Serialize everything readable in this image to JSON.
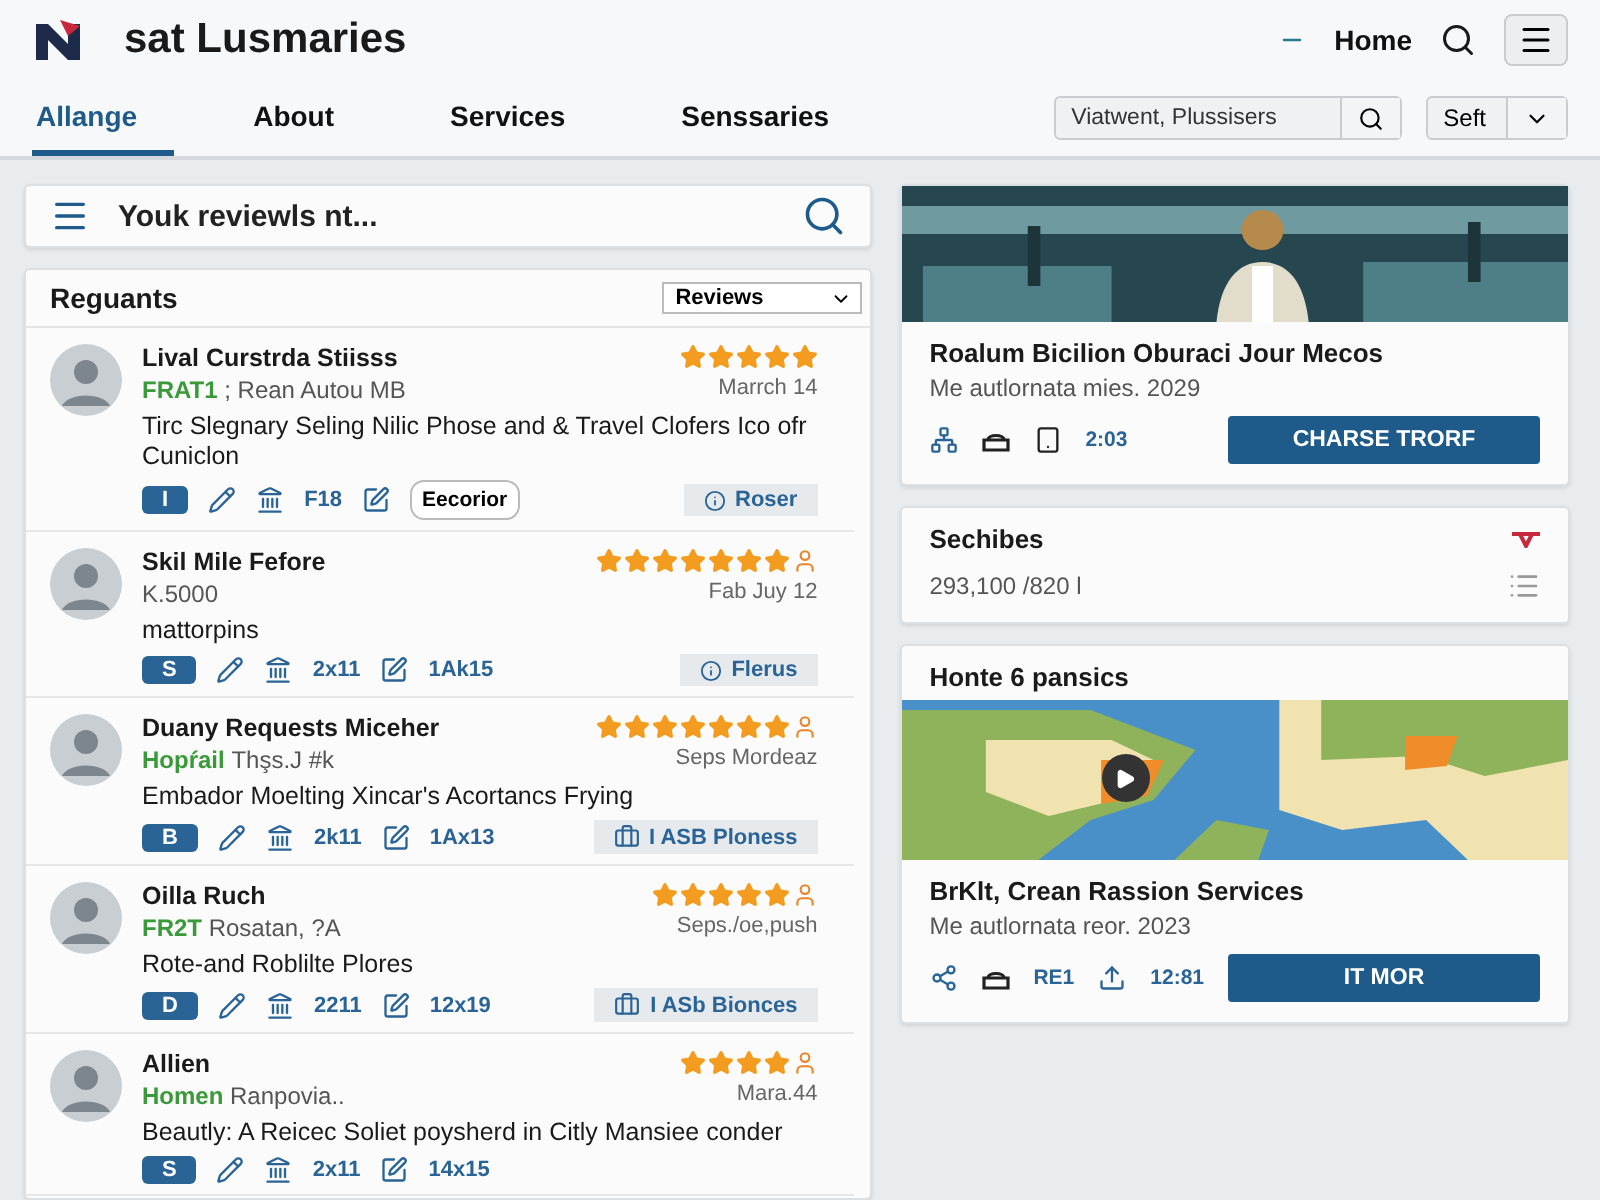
{
  "header": {
    "brand": "sat Lusmaries",
    "nav": "Home"
  },
  "tabs": [
    {
      "label": "Allange",
      "selected": true
    },
    {
      "label": "About",
      "selected": false
    },
    {
      "label": "Services",
      "selected": false
    },
    {
      "label": "Senssaries",
      "selected": false
    }
  ],
  "filter": {
    "value": "Viatwent, Plussisers",
    "select": "Seft"
  },
  "search": {
    "placeholder": "Youk reviewls nt..."
  },
  "reviews": {
    "title": "Reguants",
    "sort": "Reviews",
    "items": [
      {
        "name": "Lival Curstrda Stiisss",
        "tag": "FRAT1",
        "meta": "; Rean Autou MB",
        "stars": 5,
        "flag": false,
        "date": "Marrch 14",
        "body": "Tirc Slegnary Seling Nilic Phose and & Travel Clofers Ico ofr Cuniclon",
        "chip": "I",
        "stat1": "F18",
        "stat2": {
          "kind": "button",
          "text": "Eecorior"
        },
        "pill": {
          "kind": "info",
          "text": "Roser"
        }
      },
      {
        "name": "Skil Mile Fefore",
        "meta": "K.5000",
        "stars": 7,
        "flag": true,
        "date": "Fab Juy 12",
        "body": "mattorpins",
        "chip": "S",
        "stat1": "2x11",
        "stat2": {
          "kind": "text",
          "text": "1Ak15"
        },
        "pill": {
          "kind": "info",
          "text": "Flerus"
        }
      },
      {
        "name": "Duany Requests Miceher",
        "tag": "Hopŕail",
        "meta": "Thşs.J #k",
        "stars": 7,
        "flag": true,
        "date": "Seps Mordeaz",
        "body": "Embador Moelting Xincar's Acortancs Frying",
        "chip": "B",
        "stat1": "2k11",
        "stat2": {
          "kind": "text",
          "text": "1Ax13"
        },
        "pill": {
          "kind": "case",
          "text": "I ASB Ploness"
        }
      },
      {
        "name": "Oilla Ruch",
        "tag": "FR2T",
        "meta": "Rosatan, ?A",
        "stars": 5,
        "flag": true,
        "date": "Seps./oe,push",
        "body": "Rote-and Roblilte Plores",
        "chip": "D",
        "stat1": "2211",
        "stat2": {
          "kind": "text",
          "text": "12x19"
        },
        "pill": {
          "kind": "case",
          "text": "I ASb Bionces"
        }
      },
      {
        "name": "Allien",
        "tag": "Homen",
        "meta": "Ranpovia..",
        "stars": 4,
        "flag": true,
        "date": "Mara.44",
        "body": "Beautly: A Reicec Soliet poysherd in Citly Mansiee conder",
        "chip": "S",
        "stat1": "2x11",
        "stat2": {
          "kind": "text",
          "text": "14x15"
        }
      }
    ]
  },
  "feature": {
    "title": "Roalum Bicilion Oburaci Jour Mecos",
    "subtitle": "Me autlornata mies. 2029",
    "time": "2:03",
    "button": "CHARSE TRORF"
  },
  "stats": {
    "title": "Sechibes",
    "value": "293,100 /820 l"
  },
  "map_card": {
    "title": "Honte 6 pansics",
    "name": "BrKlt, Crean Rassion Services",
    "subtitle": "Me autlornata reor. 2023",
    "code": "RE1",
    "time": "12:81",
    "button": "IT MOR"
  }
}
